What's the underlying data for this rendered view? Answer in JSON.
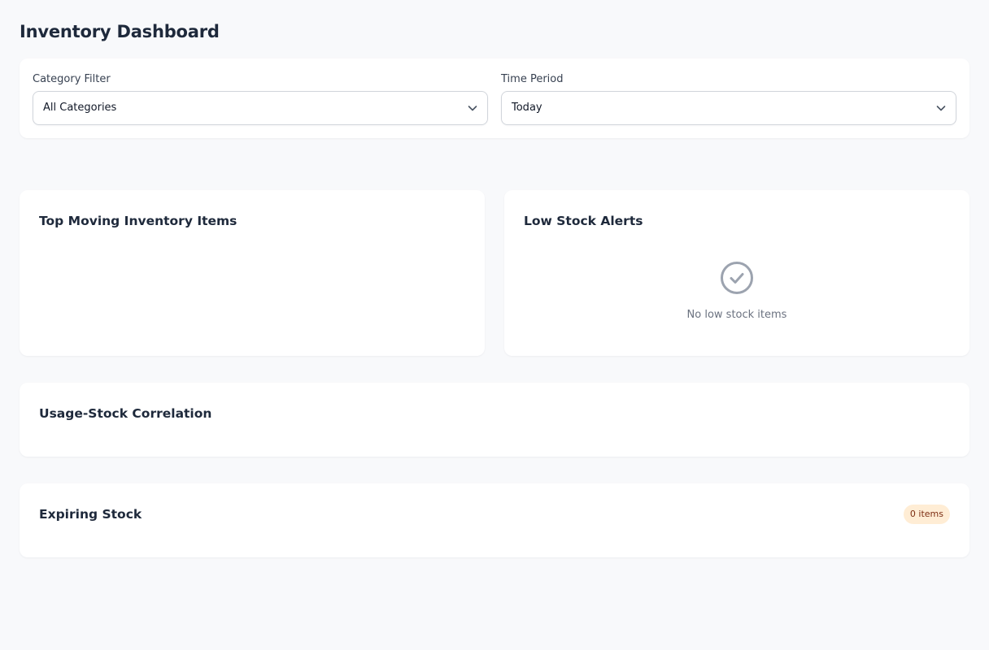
{
  "header": {
    "title": "Inventory Dashboard"
  },
  "filters": {
    "category": {
      "label": "Category Filter",
      "value": "All Categories",
      "icon": "chevron-down-icon"
    },
    "time_period": {
      "label": "Time Period",
      "value": "Today",
      "icon": "chevron-down-icon"
    }
  },
  "top_moving": {
    "title": "Top Moving Inventory Items"
  },
  "low_stock": {
    "title": "Low Stock Alerts",
    "empty_icon": "check-circle-icon",
    "empty_text": "No low stock items"
  },
  "correlation": {
    "title": "Usage-Stock Correlation"
  },
  "expiring": {
    "title": "Expiring Stock",
    "badge": "0 items"
  },
  "colors": {
    "page_background": "#f8f9fb",
    "card_background": "#ffffff",
    "badge_background": "#ffedd5",
    "badge_text": "#7c2d12",
    "muted_icon": "#9ca3af"
  }
}
